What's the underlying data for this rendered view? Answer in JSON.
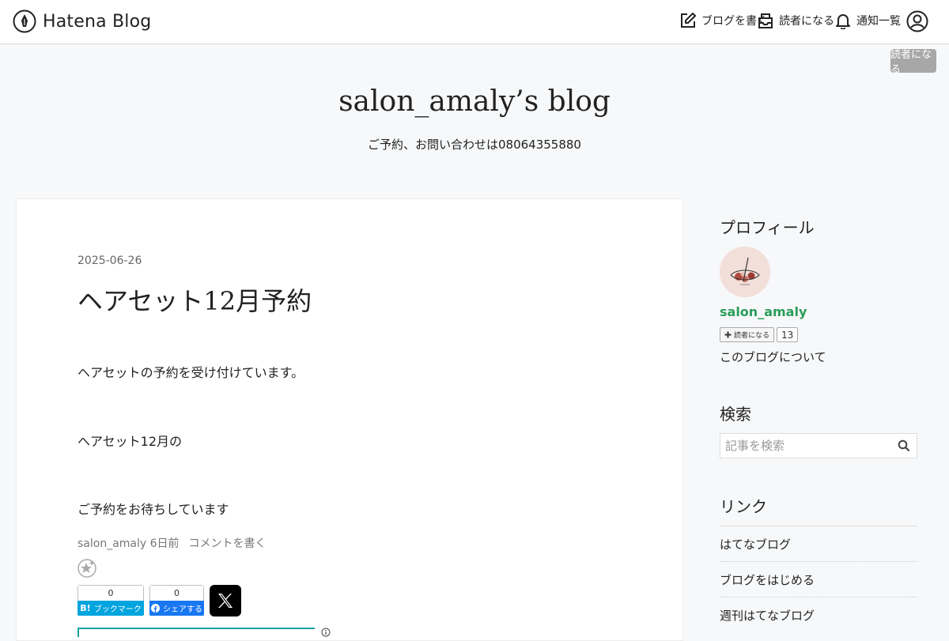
{
  "topbar": {
    "logo_text": "Hatena Blog",
    "nav": {
      "write": "ブログを書く",
      "reader": "読者になる",
      "notifications": "通知一覧"
    }
  },
  "tiny_button": "読者になる",
  "header": {
    "title": "salon_amaly’s blog",
    "description": "ご予約、お問い合わせは08064355880"
  },
  "article": {
    "date": "2025-06-26",
    "title": "ヘアセット12月予約",
    "paragraphs": [
      "ヘアセットの予約を受け付けています。",
      "ヘアセット12月の",
      "ご予約をお待ちしています"
    ],
    "author": "salon_amaly",
    "time_ago": "6日前",
    "comment_link": "コメントを書く",
    "bookmark_count": "0",
    "bookmark_label": "ブックマーク",
    "facebook_count": "0",
    "facebook_label": "シェアする"
  },
  "sidebar": {
    "profile_title": "プロフィール",
    "author_name": "salon_amaly",
    "reader_button": "読者になる",
    "reader_count": "13",
    "author_link": "このブログについて",
    "search_title": "検索",
    "search_placeholder": "記事を検索",
    "categories_title": "リンク",
    "categories": [
      "はてなブログ",
      "ブログをはじめる",
      "週刊はてなブログ"
    ]
  },
  "colors": {
    "author_green": "#2a9d5b",
    "bookmark_blue": "#00a4de",
    "facebook_blue": "#1877f2",
    "embed_teal": "#1aa1a1"
  }
}
